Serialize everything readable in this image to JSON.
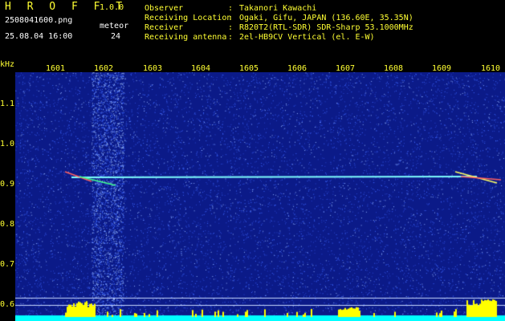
{
  "header": {
    "app_title": "H R O F F T",
    "app_version": "1.0.0",
    "filename": "2508041600.png",
    "datetime": "25.08.04 16:00",
    "meteor_label": "meteor",
    "meteor_count": "24",
    "info": [
      {
        "key": "Observer",
        "value": "Takanori Kawachi"
      },
      {
        "key": "Receiving Location",
        "value": "Ogaki, Gifu, JAPAN (136.60E, 35.35N)"
      },
      {
        "key": "Receiver",
        "value": "R820T2(RTL-SDR) SDR-Sharp 53.1000MHz"
      },
      {
        "key": "Receiving antenna",
        "value": "2el-HB9CV Vertical (el. E-W)"
      }
    ],
    "separator": ":"
  },
  "spectrogram": {
    "y_unit": "kHz",
    "y_ticks": [
      "1.1",
      "1.0",
      "0.9",
      "0.8",
      "0.7",
      "0.6"
    ],
    "x_ticks": [
      "1601",
      "1602",
      "1603",
      "1604",
      "1605",
      "1606",
      "1607",
      "1608",
      "1609",
      "1610"
    ],
    "colors": {
      "background": "#0b1a88",
      "noise": "#3d66ff",
      "carrier": "#7fffff",
      "histogram": "#ffff00",
      "baseline": "#00ffff",
      "text": "#ffff33"
    }
  }
}
